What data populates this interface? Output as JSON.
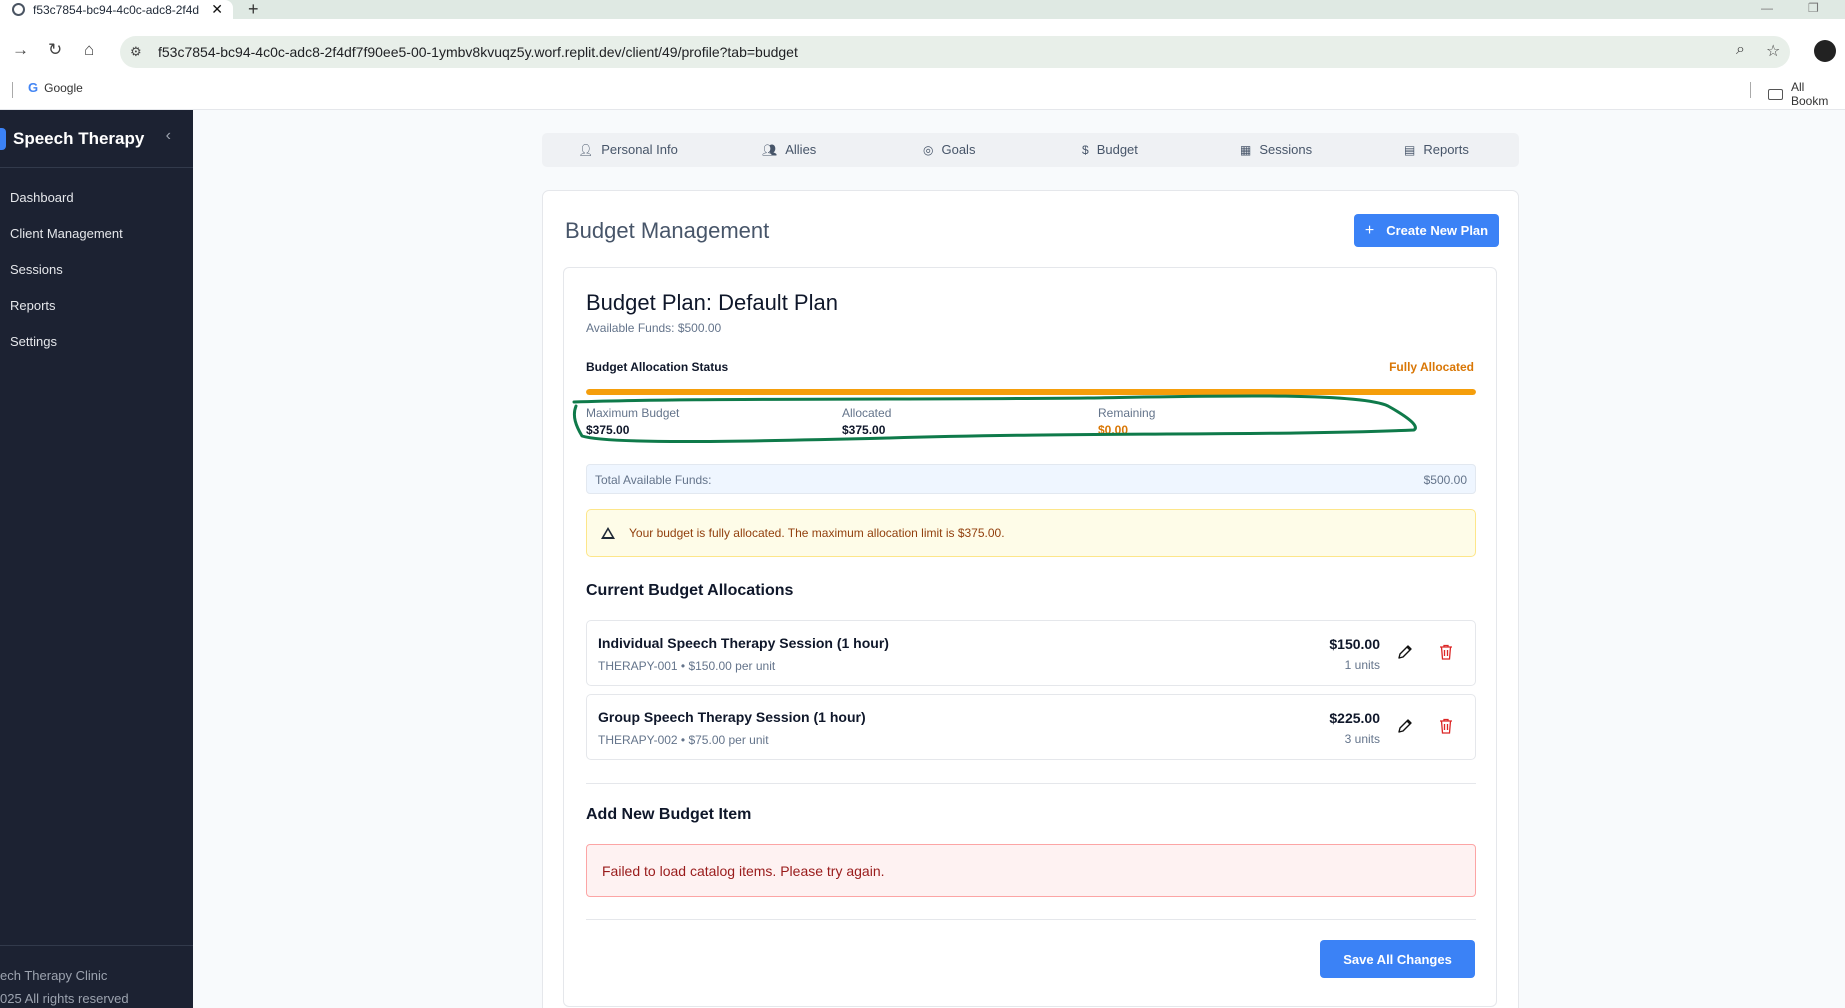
{
  "browser": {
    "tab_title": "f53c7854-bc94-4c0c-adc8-2f4d",
    "url": "f53c7854-bc94-4c0c-adc8-2f4df7f90ee5-00-1ymbv8kvuqz5y.worf.replit.dev/client/49/profile?tab=budget",
    "bookmark_google": "Google",
    "bookmark_all": "All Bookm"
  },
  "sidebar": {
    "brand": "Speech Therapy",
    "items": [
      {
        "label": "Dashboard"
      },
      {
        "label": "Client Management"
      },
      {
        "label": "Sessions"
      },
      {
        "label": "Reports"
      },
      {
        "label": "Settings"
      }
    ],
    "footer_line1": "ech Therapy Clinic",
    "footer_line2": "025 All rights reserved"
  },
  "profile_tabs": [
    {
      "label": "Personal Info",
      "icon": "user-icon"
    },
    {
      "label": "Allies",
      "icon": "users-icon"
    },
    {
      "label": "Goals",
      "icon": "target-icon"
    },
    {
      "label": "Budget",
      "icon": "dollar-icon"
    },
    {
      "label": "Sessions",
      "icon": "calendar-icon"
    },
    {
      "label": "Reports",
      "icon": "file-icon"
    }
  ],
  "main": {
    "title": "Budget Management",
    "create_button": "Create New Plan",
    "plan": {
      "title": "Budget Plan: Default Plan",
      "available": "Available Funds: $500.00",
      "allocation_status_label": "Budget Allocation Status",
      "allocation_status": "Fully Allocated",
      "allocation_fraction": 1.0,
      "stats": {
        "max_label": "Maximum Budget",
        "max_value": "$375.00",
        "allocated_label": "Allocated",
        "allocated_value": "$375.00",
        "remaining_label": "Remaining",
        "remaining_value": "$0.00"
      },
      "total_label": "Total Available Funds:",
      "total_value": "$500.00",
      "warning": "Your budget is fully allocated. The maximum allocation limit is $375.00.",
      "current_title": "Current Budget Allocations",
      "items": [
        {
          "name": "Individual Speech Therapy Session (1 hour)",
          "meta": "THERAPY-001 • $150.00 per unit",
          "amount": "$150.00",
          "units": "1 units"
        },
        {
          "name": "Group Speech Therapy Session (1 hour)",
          "meta": "THERAPY-002 • $75.00 per unit",
          "amount": "$225.00",
          "units": "3 units"
        }
      ],
      "add_title": "Add New Budget Item",
      "error": "Failed to load catalog items. Please try again.",
      "save_button": "Save All Changes"
    }
  },
  "colors": {
    "primary": "#3b82f6",
    "sidebar": "#1c2232",
    "warning": "#d97706",
    "highlight_annotation": "#0f7a4a"
  }
}
